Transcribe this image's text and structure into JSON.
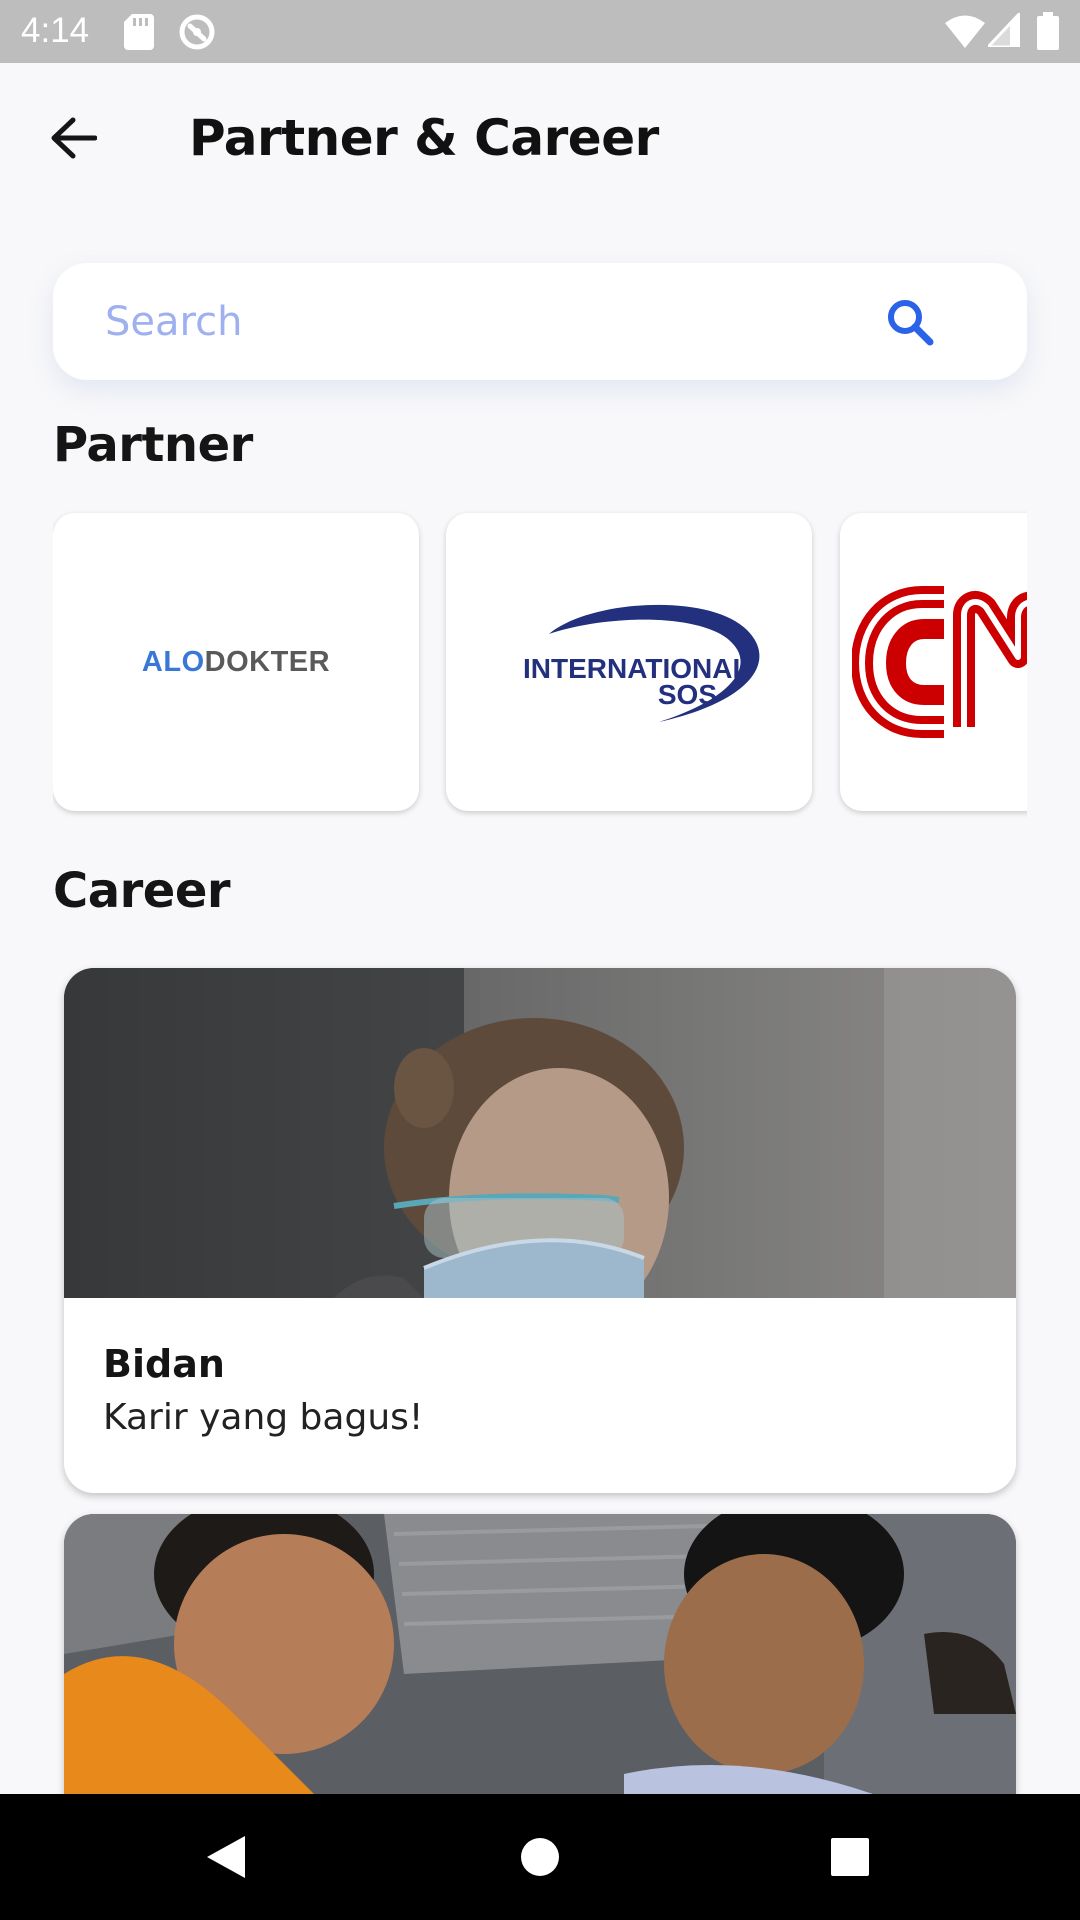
{
  "status_bar": {
    "time": "4:14",
    "icons": [
      "sd-card-icon",
      "sync-icon",
      "wifi-icon",
      "signal-icon",
      "battery-icon"
    ]
  },
  "app_bar": {
    "title": "Partner & Career",
    "back_icon": "arrow-back-icon"
  },
  "search": {
    "placeholder": "Search",
    "value": "",
    "icon": "search-icon",
    "icon_color": "#2a62e8",
    "placeholder_color": "#9fb0f0"
  },
  "partner_section": {
    "heading": "Partner",
    "partners": [
      {
        "name": "Alodokter",
        "logo_parts": [
          "ALO",
          "DOKTER"
        ],
        "colors": [
          "#3a78d8",
          "#5a5a5a"
        ]
      },
      {
        "name": "International SOS",
        "logo_lines": [
          "INTERNATIONAL",
          "SOS"
        ],
        "color": "#22307e"
      },
      {
        "name": "CNN",
        "color": "#cc0000"
      }
    ]
  },
  "career_section": {
    "heading": "Career",
    "jobs": [
      {
        "title": "Bidan",
        "subtitle": "Karir yang bagus!"
      },
      {
        "title": "",
        "subtitle": ""
      }
    ]
  },
  "nav_bar": {
    "buttons": [
      "back-triangle-icon",
      "home-circle-icon",
      "recents-square-icon"
    ]
  }
}
